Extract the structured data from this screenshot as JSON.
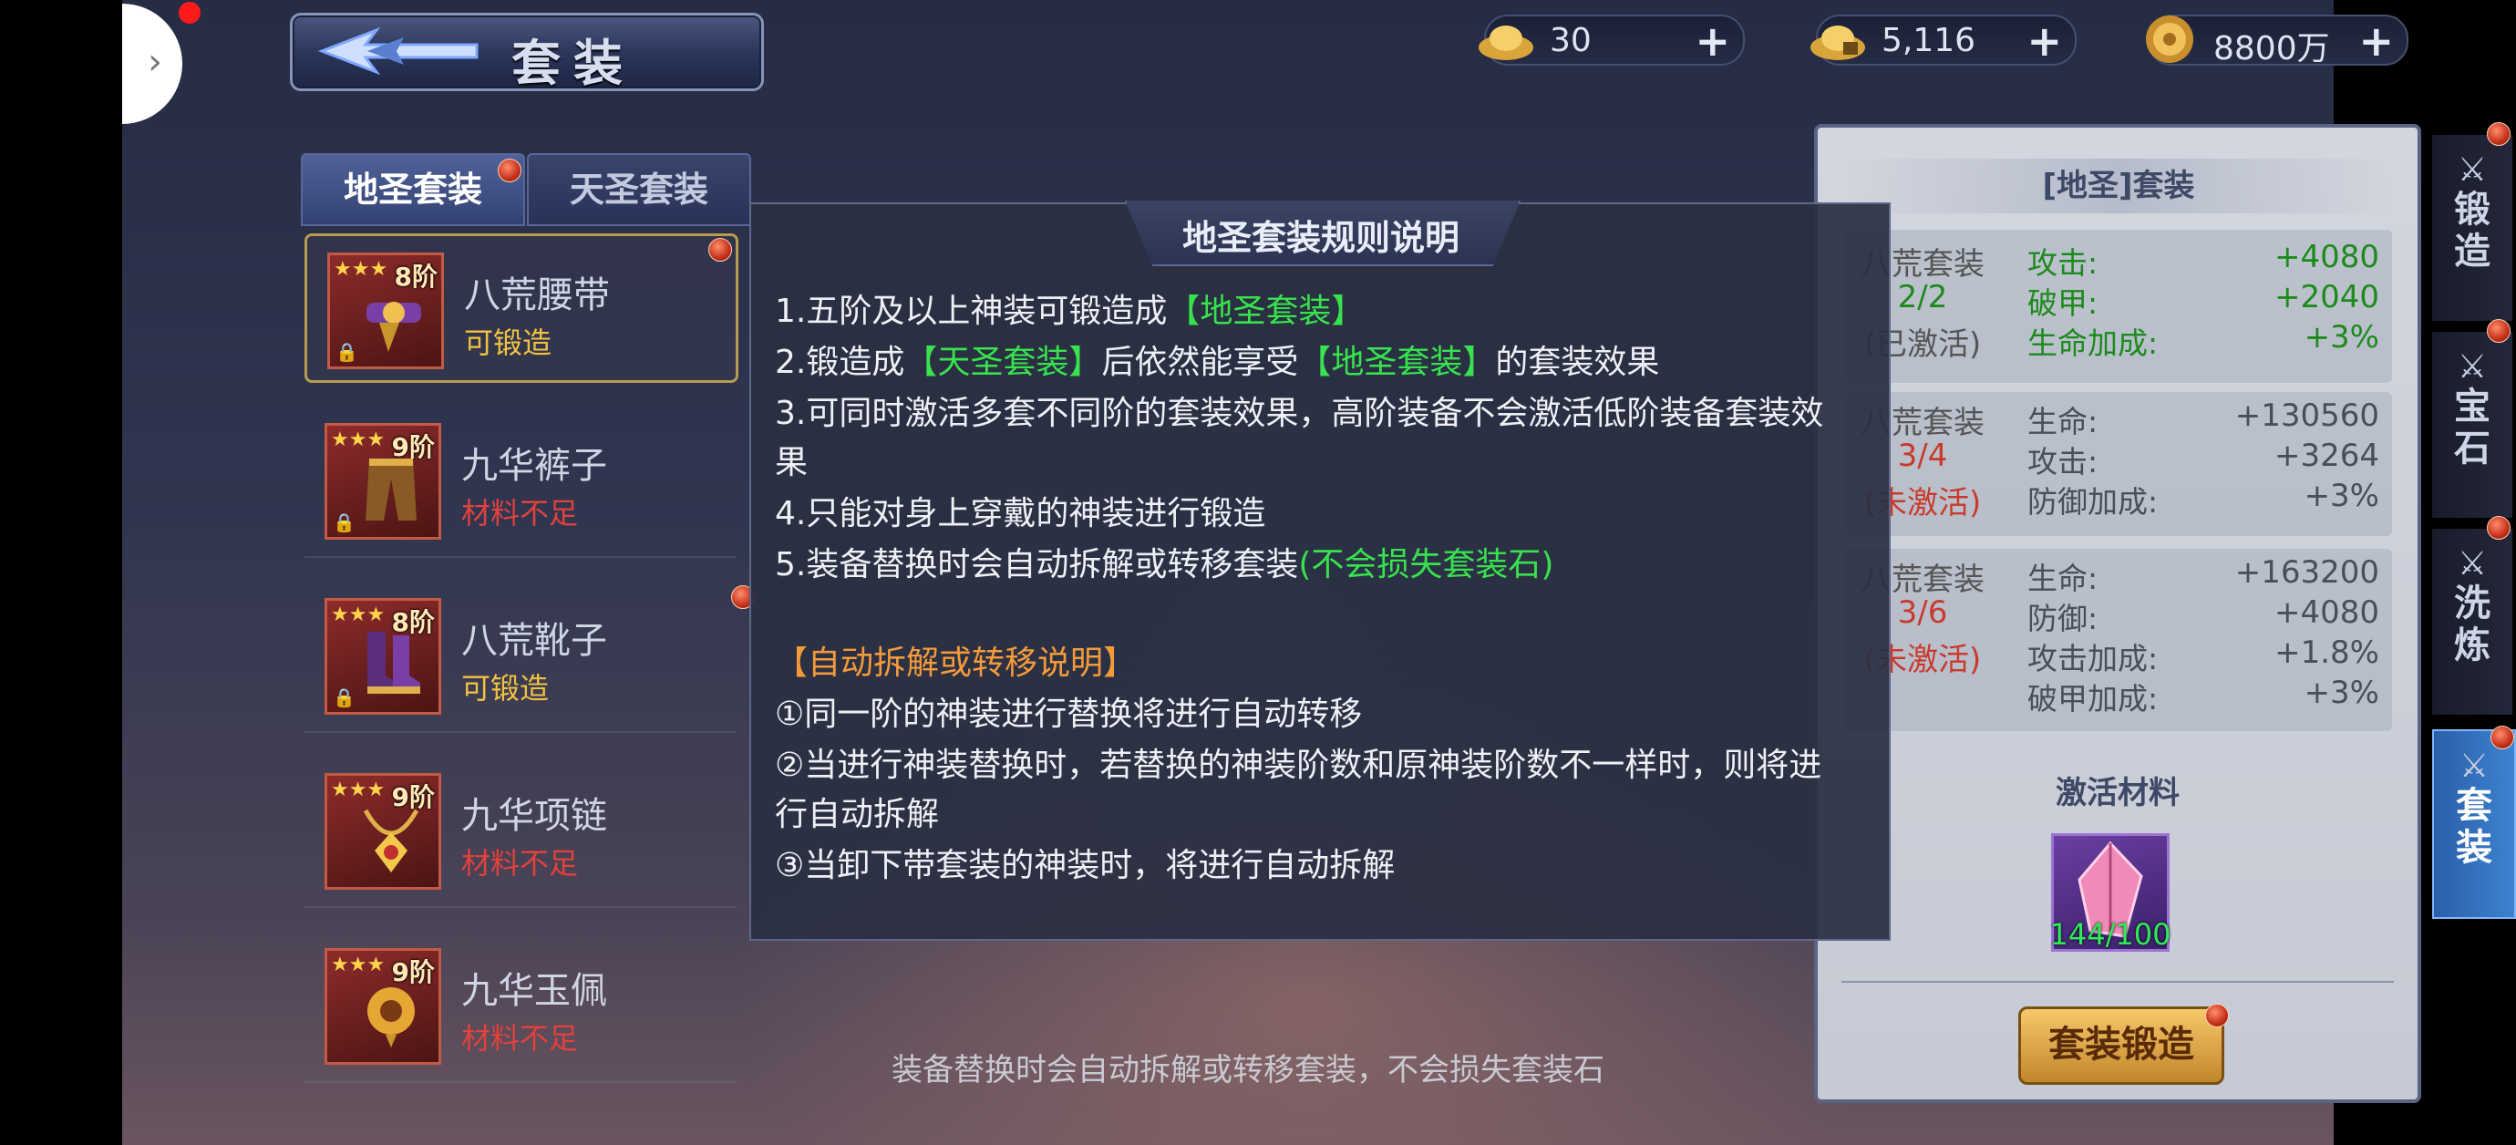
{
  "header": {
    "title": "套装"
  },
  "currency": [
    {
      "icon": "gold-ingot-icon",
      "value": "30"
    },
    {
      "icon": "locked-ingot-icon",
      "value": "5,116"
    },
    {
      "icon": "coin-icon",
      "value": "8800万"
    }
  ],
  "tabs": [
    {
      "label": "地圣套装"
    },
    {
      "label": "天圣套装"
    }
  ],
  "equipment": [
    {
      "tier": "8阶",
      "name": "八荒腰带",
      "status": "可锻造"
    },
    {
      "tier": "9阶",
      "name": "九华裤子",
      "status": "材料不足"
    },
    {
      "tier": "8阶",
      "name": "八荒靴子",
      "status": "可锻造"
    },
    {
      "tier": "9阶",
      "name": "九华项链",
      "status": "材料不足"
    },
    {
      "tier": "9阶",
      "name": "九华玉佩",
      "status": "材料不足"
    }
  ],
  "modal": {
    "title": "地圣套装规则说明",
    "rule1_a": "1.五阶及以上神装可锻造成",
    "rule1_b": "【地圣套装】",
    "rule2_a": "2.锻造成",
    "rule2_b": "【天圣套装】",
    "rule2_c": "后依然能享受",
    "rule2_d": "【地圣套装】",
    "rule2_e": "的套装效果",
    "rule3_a": "3.可同时激活多套不同阶的套装效果，高阶装备不会激活低阶装备套装效",
    "rule3_b": "果",
    "rule4": "4.只能对身上穿戴的神装进行锻造",
    "rule5_a": "5.装备替换时会自动拆解或转移套装",
    "rule5_b": "(不会损失套装石)",
    "sub_title": "【自动拆解或转移说明】",
    "sub1": "①同一阶的神装进行替换将进行自动转移",
    "sub2_a": "②当进行神装替换时，若替换的神装阶数和原神装阶数不一样时，则将进",
    "sub2_b": "行自动拆解",
    "sub3": "③当卸下带套装的神装时，将进行自动拆解"
  },
  "panel": {
    "title": "[地圣]套装",
    "sets": [
      {
        "name": "八荒套装",
        "progress": "2/2",
        "state": "(已激活)",
        "stats": [
          {
            "label": "攻击:",
            "value": "+4080"
          },
          {
            "label": "破甲:",
            "value": "+2040"
          },
          {
            "label": "生命加成:",
            "value": "+3%"
          }
        ]
      },
      {
        "name": "八荒套装",
        "progress": "3/4",
        "state": "(未激活)",
        "stats": [
          {
            "label": "生命:",
            "value": "+130560"
          },
          {
            "label": "攻击:",
            "value": "+3264"
          },
          {
            "label": "防御加成:",
            "value": "+3%"
          }
        ]
      },
      {
        "name": "八荒套装",
        "progress": "3/6",
        "state": "(未激活)",
        "stats": [
          {
            "label": "生命:",
            "value": "+163200"
          },
          {
            "label": "防御:",
            "value": "+4080"
          },
          {
            "label": "攻击加成:",
            "value": "+1.8%"
          },
          {
            "label": "破甲加成:",
            "value": "+3%"
          }
        ]
      }
    ],
    "material_title": "激活材料",
    "material_count": "144/100",
    "forge_button": "套装锻造"
  },
  "side_nav": [
    {
      "label": "锻造"
    },
    {
      "label": "宝石"
    },
    {
      "label": "洗炼"
    },
    {
      "label": "套装"
    }
  ],
  "bottom_hint": "装备替换时会自动拆解或转移套装，不会损失套装石",
  "colors": {
    "accent_green": "#38e24e",
    "warn_red": "#e2413c",
    "ok_yellow": "#f2c241",
    "orange": "#f39a3a"
  }
}
